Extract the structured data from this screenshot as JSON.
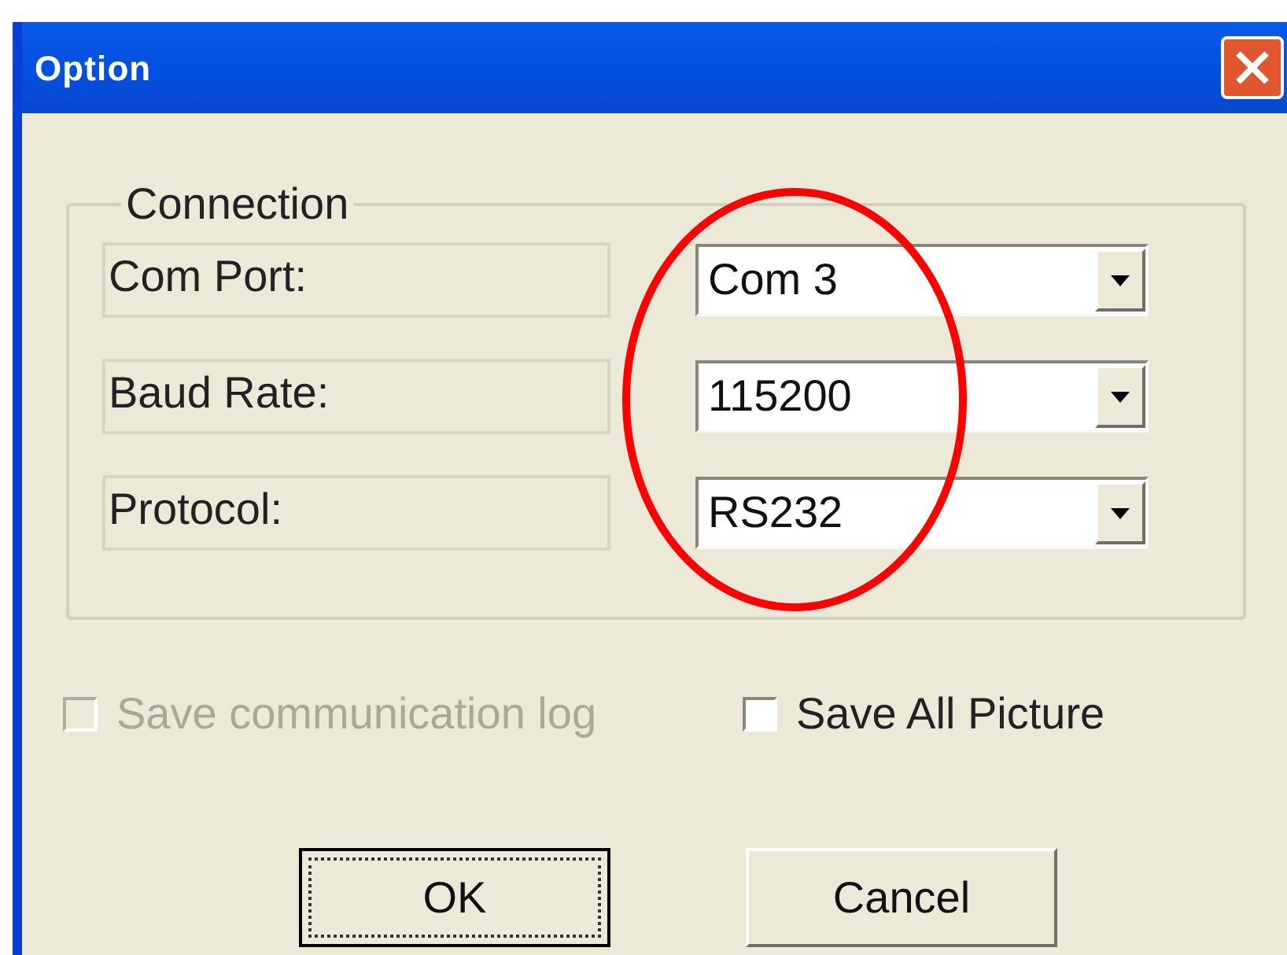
{
  "window": {
    "title": "Option"
  },
  "connection": {
    "legend": "Connection",
    "fields": [
      {
        "label": "Com Port:",
        "value": "Com 3"
      },
      {
        "label": "Baud Rate:",
        "value": "115200"
      },
      {
        "label": "Protocol:",
        "value": "RS232"
      }
    ]
  },
  "options": [
    {
      "label": "Save communication log",
      "checked": false,
      "disabled": true
    },
    {
      "label": "Save All Picture",
      "checked": false,
      "disabled": false
    }
  ],
  "buttons": [
    {
      "label": "OK",
      "default": true
    },
    {
      "label": "Cancel",
      "default": false
    }
  ],
  "highlight": {
    "color": "#ff0000"
  }
}
